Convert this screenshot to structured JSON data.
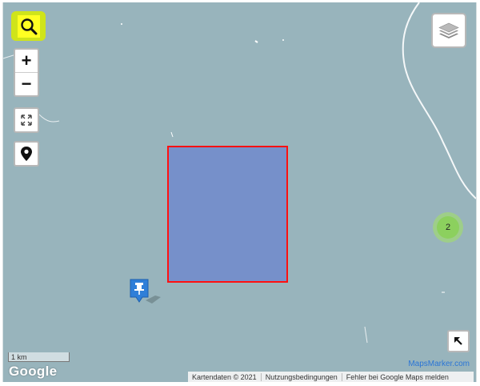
{
  "map": {
    "background_color": "#98b4bc",
    "polygon": {
      "fill_color": "#7690ca",
      "stroke_color": "#ff1010"
    },
    "cluster": {
      "count": "2",
      "color": "#8cd05e"
    },
    "marker": {
      "color": "#2f7fd8",
      "icon": "pushpin-icon"
    }
  },
  "controls": {
    "search_icon": "search-icon",
    "zoom_in_label": "+",
    "zoom_out_label": "−",
    "fullscreen_icon": "fullscreen-icon",
    "locate_icon": "location-pin-icon",
    "layers_icon": "layers-icon",
    "expand_icon": "arrow-up-left-icon"
  },
  "scale": {
    "label": "1 km"
  },
  "branding": {
    "google_logo": "Google",
    "mapsmarker_link": "MapsMarker.com"
  },
  "attribution": {
    "map_data": "Kartendaten © 2021",
    "terms": "Nutzungsbedingungen",
    "report_error": "Fehler bei Google Maps melden"
  }
}
